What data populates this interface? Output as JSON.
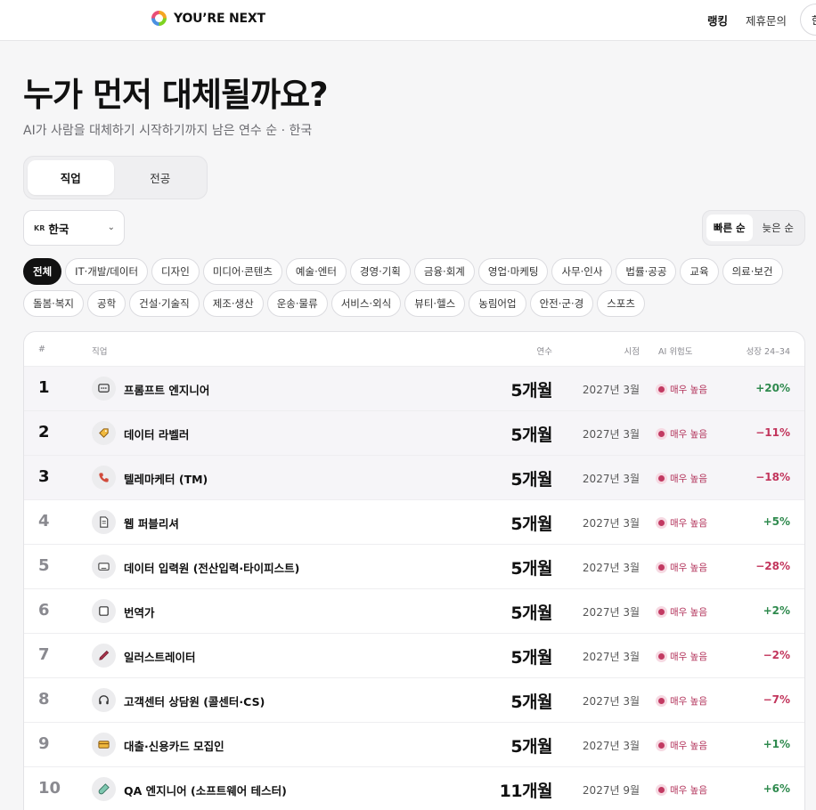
{
  "header": {
    "brand": "YOU’RE NEXT",
    "nav": [
      {
        "label": "랭킹"
      },
      {
        "label": "제휴문의"
      }
    ],
    "lang_chip": "한"
  },
  "hero": {
    "title": "누가 먼저 대체될까요?",
    "subtitle": "AI가 사람을 대체하기 시작하기까지 남은 연수 순 · 한국"
  },
  "tabs": [
    {
      "label": "직업",
      "active": true
    },
    {
      "label": "전공",
      "active": false
    }
  ],
  "country": {
    "flag": "KR",
    "label": "한국",
    "chevron": "⌄"
  },
  "sort": [
    {
      "label": "빠른 순",
      "active": true
    },
    {
      "label": "늦은 순",
      "active": false
    }
  ],
  "categories": [
    {
      "label": "전체",
      "active": true
    },
    {
      "label": "IT·개발/데이터"
    },
    {
      "label": "디자인"
    },
    {
      "label": "미디어·콘텐츠"
    },
    {
      "label": "예술·엔터"
    },
    {
      "label": "경영·기획"
    },
    {
      "label": "금융·회계"
    },
    {
      "label": "영업·마케팅"
    },
    {
      "label": "사무·인사"
    },
    {
      "label": "법률·공공"
    },
    {
      "label": "교육"
    },
    {
      "label": "의료·보건"
    },
    {
      "label": "돌봄·복지"
    },
    {
      "label": "공학"
    },
    {
      "label": "건설·기술직"
    },
    {
      "label": "제조·생산"
    },
    {
      "label": "운송·물류"
    },
    {
      "label": "서비스·외식"
    },
    {
      "label": "뷰티·헬스"
    },
    {
      "label": "농림어업"
    },
    {
      "label": "안전·군·경"
    },
    {
      "label": "스포츠"
    }
  ],
  "table": {
    "headers": {
      "rank": "#",
      "job": "직업",
      "years": "연수",
      "when": "시점",
      "risk": "AI 위험도",
      "growth": "성장 24–34"
    },
    "rows": [
      {
        "rank": "1",
        "icon": "chat-bubble-icon",
        "job": "프롬프트 엔지니어",
        "years": "5개월",
        "when": "2027년 3월",
        "risk": "매우 높음",
        "growth": "+20%"
      },
      {
        "rank": "2",
        "icon": "tag-icon",
        "job": "데이터 라벨러",
        "years": "5개월",
        "when": "2027년 3월",
        "risk": "매우 높음",
        "growth": "−11%"
      },
      {
        "rank": "3",
        "icon": "phone-icon",
        "job": "텔레마케터 (TM)",
        "years": "5개월",
        "when": "2027년 3월",
        "risk": "매우 높음",
        "growth": "−18%"
      },
      {
        "rank": "4",
        "icon": "document-icon",
        "job": "웹 퍼블리셔",
        "years": "5개월",
        "when": "2027년 3월",
        "risk": "매우 높음",
        "growth": "+5%"
      },
      {
        "rank": "5",
        "icon": "keyboard-icon",
        "job": "데이터 입력원 (전산입력·타이피스트)",
        "years": "5개월",
        "when": "2027년 3월",
        "risk": "매우 높음",
        "growth": "−28%"
      },
      {
        "rank": "6",
        "icon": "book-icon",
        "job": "번역가",
        "years": "5개월",
        "when": "2027년 3월",
        "risk": "매우 높음",
        "growth": "+2%"
      },
      {
        "rank": "7",
        "icon": "pen-icon",
        "job": "일러스트레이터",
        "years": "5개월",
        "when": "2027년 3월",
        "risk": "매우 높음",
        "growth": "−2%"
      },
      {
        "rank": "8",
        "icon": "headset-icon",
        "job": "고객센터 상담원 (콜센터·CS)",
        "years": "5개월",
        "when": "2027년 3월",
        "risk": "매우 높음",
        "growth": "−7%"
      },
      {
        "rank": "9",
        "icon": "card-icon",
        "job": "대출·신용카드 모집인",
        "years": "5개월",
        "when": "2027년 3월",
        "risk": "매우 높음",
        "growth": "+1%"
      },
      {
        "rank": "10",
        "icon": "test-tube-icon",
        "job": "QA 엔지니어 (소프트웨어 테스터)",
        "years": "11개월",
        "when": "2027년 9월",
        "risk": "매우 높음",
        "growth": "+6%"
      }
    ]
  }
}
